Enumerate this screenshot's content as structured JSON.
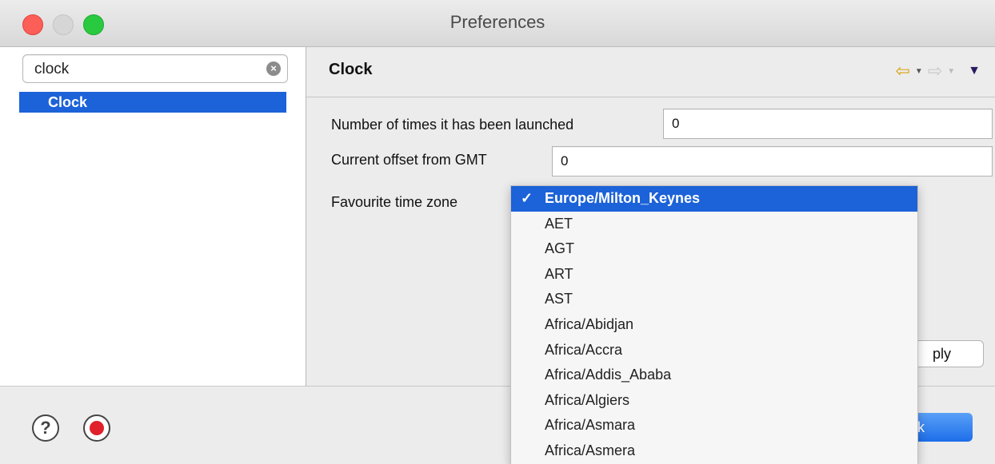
{
  "window": {
    "title": "Preferences"
  },
  "sidebar": {
    "search": {
      "value": "clock",
      "placeholder": ""
    },
    "items": [
      {
        "label": "Clock",
        "selected": true
      }
    ]
  },
  "page": {
    "title": "Clock",
    "fields": {
      "launch_count_label": "Number of times it has been launched",
      "launch_count_value": "0",
      "gmt_offset_label": "Current offset from GMT",
      "gmt_offset_value": "0",
      "timezone_label": "Favourite time zone"
    },
    "apply_label": "ply"
  },
  "timezone_menu": {
    "selected": "Europe/Milton_Keynes",
    "check": "✓",
    "options": [
      "Europe/Milton_Keynes",
      "AET",
      "AGT",
      "ART",
      "AST",
      "Africa/Abidjan",
      "Africa/Accra",
      "Africa/Addis_Ababa",
      "Africa/Algiers",
      "Africa/Asmara",
      "Africa/Asmera"
    ]
  },
  "footer": {
    "ok_label": "k",
    "help_icon_glyph": "?"
  },
  "colors": {
    "selection": "#1c62d8",
    "close": "#fc5f57",
    "maximize": "#29c940",
    "back_arrow": "#d9a30e",
    "record": "#e0202a"
  },
  "icons": [
    "close-window-icon",
    "minimize-window-icon",
    "maximize-window-icon",
    "clear-search-icon",
    "back-arrow-icon",
    "forward-arrow-icon",
    "view-menu-icon",
    "help-icon",
    "record-macro-icon",
    "checkmark-icon"
  ]
}
